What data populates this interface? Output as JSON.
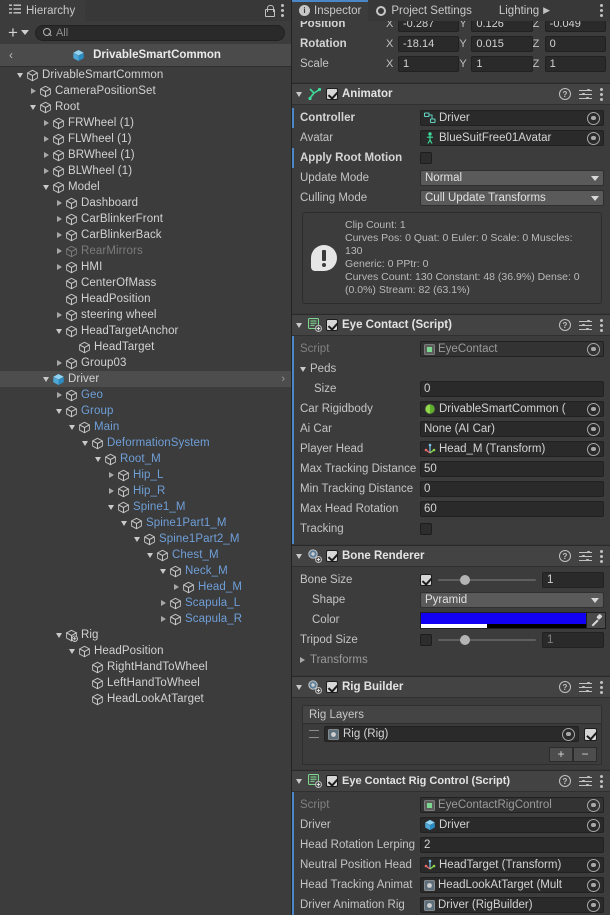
{
  "hierarchy": {
    "tab_label": "Hierarchy",
    "toolbar": {
      "add_label": "+",
      "search_placeholder": "All"
    },
    "breadcrumb": {
      "back": "‹",
      "label": "DrivableSmartCommon"
    },
    "rows": [
      {
        "indent": 1,
        "arrow": "down",
        "label": "DrivableSmartCommon",
        "color": "white",
        "icon": "cube"
      },
      {
        "indent": 2,
        "arrow": "right",
        "label": "CameraPositionSet",
        "color": "white",
        "icon": "cube"
      },
      {
        "indent": 2,
        "arrow": "down",
        "label": "Root",
        "color": "white",
        "icon": "cube"
      },
      {
        "indent": 3,
        "arrow": "right",
        "label": "FRWheel (1)",
        "color": "white",
        "icon": "cube"
      },
      {
        "indent": 3,
        "arrow": "right",
        "label": "FLWheel (1)",
        "color": "white",
        "icon": "cube"
      },
      {
        "indent": 3,
        "arrow": "right",
        "label": "BRWheel (1)",
        "color": "white",
        "icon": "cube"
      },
      {
        "indent": 3,
        "arrow": "right",
        "label": "BLWheel (1)",
        "color": "white",
        "icon": "cube"
      },
      {
        "indent": 3,
        "arrow": "down",
        "label": "Model",
        "color": "white",
        "icon": "cube"
      },
      {
        "indent": 4,
        "arrow": "right",
        "label": "Dashboard",
        "color": "white",
        "icon": "cube"
      },
      {
        "indent": 4,
        "arrow": "right",
        "label": "CarBlinkerFront",
        "color": "white",
        "icon": "cube"
      },
      {
        "indent": 4,
        "arrow": "right",
        "label": "CarBlinkerBack",
        "color": "white",
        "icon": "cube"
      },
      {
        "indent": 4,
        "arrow": "right",
        "label": "RearMirrors",
        "color": "dim",
        "icon": "cube"
      },
      {
        "indent": 4,
        "arrow": "right",
        "label": "HMI",
        "color": "white",
        "icon": "cube"
      },
      {
        "indent": 4,
        "arrow": "none",
        "label": "CenterOfMass",
        "color": "white",
        "icon": "cube"
      },
      {
        "indent": 4,
        "arrow": "none",
        "label": "HeadPosition",
        "color": "white",
        "icon": "cube"
      },
      {
        "indent": 4,
        "arrow": "right",
        "label": "steering wheel",
        "color": "white",
        "icon": "cube"
      },
      {
        "indent": 4,
        "arrow": "down",
        "label": "HeadTargetAnchor",
        "color": "white",
        "icon": "cube"
      },
      {
        "indent": 5,
        "arrow": "none",
        "label": "HeadTarget",
        "color": "white",
        "icon": "cube"
      },
      {
        "indent": 4,
        "arrow": "right",
        "label": "Group03",
        "color": "white",
        "icon": "cube"
      },
      {
        "indent": 3,
        "arrow": "down",
        "label": "Driver",
        "color": "white",
        "icon": "prefab",
        "selected": true,
        "chevron": "›"
      },
      {
        "indent": 4,
        "arrow": "right",
        "label": "Geo",
        "color": "blue",
        "icon": "cube"
      },
      {
        "indent": 4,
        "arrow": "down",
        "label": "Group",
        "color": "blue",
        "icon": "cube"
      },
      {
        "indent": 5,
        "arrow": "down",
        "label": "Main",
        "color": "blue",
        "icon": "cube"
      },
      {
        "indent": 6,
        "arrow": "down",
        "label": "DeformationSystem",
        "color": "blue",
        "icon": "cube"
      },
      {
        "indent": 7,
        "arrow": "down",
        "label": "Root_M",
        "color": "blue",
        "icon": "cube"
      },
      {
        "indent": 8,
        "arrow": "right",
        "label": "Hip_L",
        "color": "blue",
        "icon": "cube"
      },
      {
        "indent": 8,
        "arrow": "right",
        "label": "Hip_R",
        "color": "blue",
        "icon": "cube"
      },
      {
        "indent": 8,
        "arrow": "down",
        "label": "Spine1_M",
        "color": "blue",
        "icon": "cube"
      },
      {
        "indent": 9,
        "arrow": "down",
        "label": "Spine1Part1_M",
        "color": "blue",
        "icon": "cube"
      },
      {
        "indent": 10,
        "arrow": "down",
        "label": "Spine1Part2_M",
        "color": "blue",
        "icon": "cube"
      },
      {
        "indent": 11,
        "arrow": "down",
        "label": "Chest_M",
        "color": "blue",
        "icon": "cube"
      },
      {
        "indent": 12,
        "arrow": "down",
        "label": "Neck_M",
        "color": "blue",
        "icon": "cube"
      },
      {
        "indent": 13,
        "arrow": "right",
        "label": "Head_M",
        "color": "blue",
        "icon": "cube"
      },
      {
        "indent": 12,
        "arrow": "right",
        "label": "Scapula_L",
        "color": "blue",
        "icon": "cube"
      },
      {
        "indent": 12,
        "arrow": "right",
        "label": "Scapula_R",
        "color": "blue",
        "icon": "cube"
      },
      {
        "indent": 4,
        "arrow": "down",
        "label": "Rig",
        "color": "white",
        "icon": "script-cube"
      },
      {
        "indent": 5,
        "arrow": "down",
        "label": "HeadPosition",
        "color": "white",
        "icon": "cube"
      },
      {
        "indent": 6,
        "arrow": "none",
        "label": "RightHandToWheel",
        "color": "white",
        "icon": "cube"
      },
      {
        "indent": 6,
        "arrow": "none",
        "label": "LeftHandToWheel",
        "color": "white",
        "icon": "cube"
      },
      {
        "indent": 6,
        "arrow": "none",
        "label": "HeadLookAtTarget",
        "color": "white",
        "icon": "cube"
      }
    ]
  },
  "inspector": {
    "tabs": [
      {
        "label": "Inspector",
        "icon": "info-icon",
        "active": true
      },
      {
        "label": "Project Settings",
        "icon": "gear-icon",
        "active": false
      },
      {
        "label": "Lighting",
        "icon": "bulb-icon",
        "active": false
      }
    ],
    "transform": {
      "rows": [
        {
          "label": "Position",
          "bold": true,
          "x": "-0.287",
          "y": "0.126",
          "z": "-0.049"
        },
        {
          "label": "Rotation",
          "bold": true,
          "x": "-18.14",
          "y": "0.015",
          "z": "0"
        },
        {
          "label": "Scale",
          "bold": false,
          "x": "1",
          "y": "1",
          "z": "1"
        }
      ],
      "axis_labels": [
        "X",
        "Y",
        "Z"
      ]
    },
    "animator": {
      "title": "Animator",
      "enabled": true,
      "rows": [
        {
          "label": "Controller",
          "bold": true,
          "type": "object",
          "value": "Driver",
          "icon": "controller-icon",
          "override": true
        },
        {
          "label": "Avatar",
          "bold": false,
          "type": "object",
          "value": "BlueSuitFree01Avatar",
          "icon": "avatar-icon",
          "override": false
        },
        {
          "label": "Apply Root Motion",
          "bold": true,
          "type": "checkbox",
          "checked": false,
          "override": true
        },
        {
          "label": "Update Mode",
          "bold": false,
          "type": "dropdown",
          "value": "Normal"
        },
        {
          "label": "Culling Mode",
          "bold": false,
          "type": "dropdown",
          "value": "Cull Update Transforms"
        }
      ],
      "info": [
        "Clip Count: 1",
        "Curves Pos: 0 Quat: 0 Euler: 0 Scale: 0 Muscles: 130",
        "Generic: 0 PPtr: 0",
        "Curves Count: 130 Constant: 48 (36.9%) Dense: 0",
        "(0.0%) Stream: 82 (63.1%)"
      ]
    },
    "eye_contact": {
      "title": "Eye Contact (Script)",
      "enabled": true,
      "rows": [
        {
          "label": "Script",
          "type": "object",
          "value": "EyeContact",
          "icon": "script-icon",
          "readonly": true
        },
        {
          "label": "Peds",
          "type": "foldout"
        },
        {
          "label": "Size",
          "type": "text",
          "value": "0",
          "indent": true
        },
        {
          "label": "Car Rigidbody",
          "type": "object",
          "value": "DrivableSmartCommon (",
          "icon": "rigidbody-icon"
        },
        {
          "label": "Ai Car",
          "type": "object",
          "value": "None (AI Car)"
        },
        {
          "label": "Player Head",
          "type": "object",
          "value": "Head_M (Transform)",
          "icon": "transform-icon"
        },
        {
          "label": "Max Tracking Distance",
          "type": "text",
          "value": "50"
        },
        {
          "label": "Min Tracking Distance",
          "type": "text",
          "value": "0"
        },
        {
          "label": "Max Head Rotation",
          "type": "text",
          "value": "60"
        },
        {
          "label": "Tracking",
          "type": "checkbox",
          "checked": false
        }
      ]
    },
    "bone_renderer": {
      "title": "Bone Renderer",
      "enabled": true,
      "bone_size": {
        "label": "Bone Size",
        "checked": true,
        "value": "1"
      },
      "shape": {
        "label": "Shape",
        "value": "Pyramid"
      },
      "color": {
        "label": "Color",
        "hex": "#1200f5",
        "alpha_percent": 40
      },
      "tripod": {
        "label": "Tripod Size",
        "checked": false,
        "value": "1"
      },
      "transforms_label": "Transforms"
    },
    "rig_builder": {
      "title": "Rig Builder",
      "enabled": true,
      "layers_header": "Rig Layers",
      "layer": {
        "value": "Rig (Rig)",
        "checked": true
      },
      "add_label": "+",
      "remove_label": "−"
    },
    "rig_control": {
      "title": "Eye Contact Rig Control (Script)",
      "enabled": true,
      "rows": [
        {
          "label": "Script",
          "type": "object",
          "value": "EyeContactRigControl",
          "icon": "script-icon",
          "readonly": true
        },
        {
          "label": "Driver",
          "type": "object",
          "value": "Driver",
          "icon": "prefab-icon"
        },
        {
          "label": "Head Rotation Lerping",
          "type": "text",
          "value": "2"
        },
        {
          "label": "Neutral Position Head",
          "type": "object",
          "value": "HeadTarget (Transform)",
          "icon": "transform-icon"
        },
        {
          "label": "Head Tracking Animat",
          "type": "object",
          "value": "HeadLookAtTarget (Mult",
          "icon": "asset-icon"
        },
        {
          "label": "Driver Animation Rig",
          "type": "object",
          "value": "Driver (RigBuilder)",
          "icon": "asset-icon"
        }
      ]
    }
  },
  "colors": {
    "accent_blue": "#4b87c6",
    "node_blue": "#6f9fd8",
    "panel_bg": "#3c3c3c",
    "header_bg": "#434343"
  }
}
